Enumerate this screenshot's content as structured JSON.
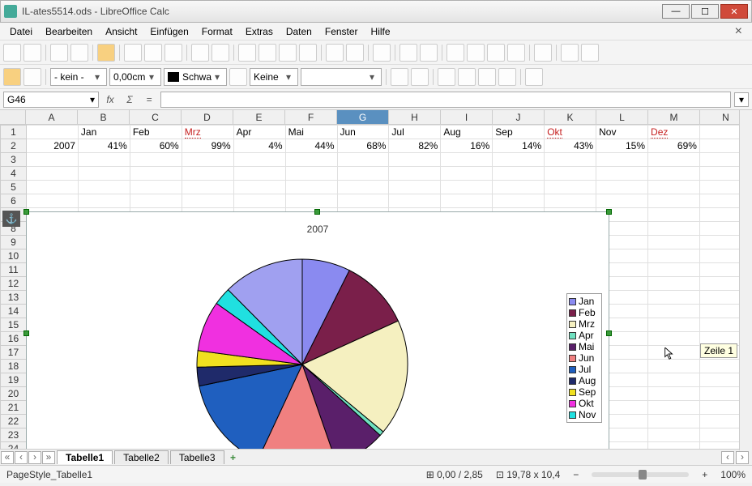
{
  "window": {
    "title": "IL-ates5514.ods - LibreOffice Calc"
  },
  "menu": {
    "items": [
      "Datei",
      "Bearbeiten",
      "Ansicht",
      "Einfügen",
      "Format",
      "Extras",
      "Daten",
      "Fenster",
      "Hilfe"
    ]
  },
  "toolbar2": {
    "style_combo": "- kein -",
    "size_combo": "0,00cm",
    "color_label": "Schwa",
    "fill_label": "Keine"
  },
  "formula": {
    "ref": "G46"
  },
  "columns": [
    "A",
    "B",
    "C",
    "D",
    "E",
    "F",
    "G",
    "H",
    "I",
    "J",
    "K",
    "L",
    "M",
    "N"
  ],
  "selected_col": "G",
  "sheet": {
    "row1": [
      "Jan",
      "Feb",
      "Mrz",
      "Apr",
      "Mai",
      "Jun",
      "Jul",
      "Aug",
      "Sep",
      "Okt",
      "Nov",
      "Dez"
    ],
    "row2_label": "2007",
    "row2": [
      "41%",
      "60%",
      "99%",
      "4%",
      "44%",
      "68%",
      "82%",
      "16%",
      "14%",
      "43%",
      "15%",
      "69%"
    ]
  },
  "chart_data": {
    "type": "pie",
    "title": "2007",
    "categories": [
      "Jan",
      "Feb",
      "Mrz",
      "Apr",
      "Mai",
      "Jun",
      "Jul",
      "Aug",
      "Sep",
      "Okt",
      "Nov",
      "Dez"
    ],
    "values": [
      41,
      60,
      99,
      4,
      44,
      68,
      82,
      16,
      14,
      43,
      15,
      69
    ],
    "colors": [
      "#8a8af0",
      "#7a1f4a",
      "#f5f0c0",
      "#6fe0c0",
      "#5a1f6a",
      "#f08080",
      "#1f5fbf",
      "#1f2a6a",
      "#f0e020",
      "#f030e0",
      "#20e0e0",
      "#a0a0f0"
    ],
    "legend_items": [
      "Jan",
      "Feb",
      "Mrz",
      "Apr",
      "Mai",
      "Jun",
      "Jul",
      "Aug",
      "Sep",
      "Okt",
      "Nov"
    ]
  },
  "tabs": {
    "items": [
      "Tabelle1",
      "Tabelle2",
      "Tabelle3"
    ],
    "active": 0
  },
  "status": {
    "pagestyle": "PageStyle_Tabelle1",
    "coords": "0,00 / 2,85",
    "size": "19,78 x 10,4",
    "zoom": "100%"
  },
  "tooltip": "Zeile 1"
}
